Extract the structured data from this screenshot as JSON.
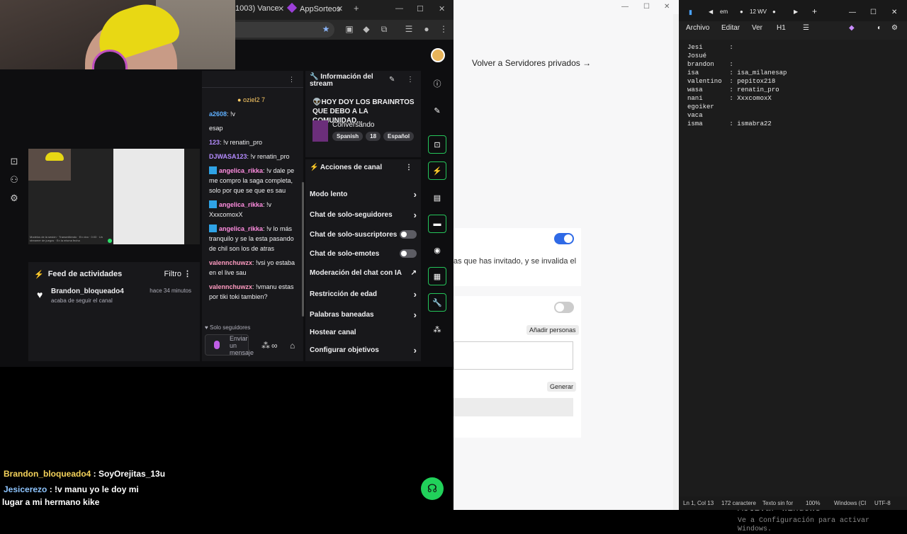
{
  "browser": {
    "tab1_label": "1003) Vance",
    "tab2_label": "AppSorteos",
    "tab1_close": "✕",
    "tab2_close": "✕",
    "new_tab": "+",
    "win_min": "—",
    "win_max": "☐",
    "win_close": "✕"
  },
  "preview": {
    "caption": "Modelos de la sesión · Transmitiendo · En vivo · 0:03 · Un streamer de juegos · En la misma fecha"
  },
  "activity_feed": {
    "title": "Feed de actividades",
    "filter_label": "Filtro",
    "event_user": "Brandon_bloqueado4",
    "event_time": "hace 34 minutos",
    "event_text": "acaba de seguir el canal"
  },
  "chat": {
    "pinned": "oziel2 7",
    "messages": [
      {
        "user": "a2608",
        "text": ": !v",
        "color": "#5fb0ff"
      },
      {
        "user": "",
        "text": "esap",
        "color": "#efeff1"
      },
      {
        "user": "123",
        "text": ": !v renatin_pro",
        "color": "#b58cff"
      },
      {
        "user": "DJWASA123",
        "text": ": !v renatin_pro",
        "color": "#b58cff"
      },
      {
        "user": "angelica_rikka",
        "text": ": !v dale pe me compro la saga completa, solo por que se que es sau",
        "color": "#ff8de0",
        "badge": true
      },
      {
        "user": "angelica_rikka",
        "text": ": !v XxxcomoxX",
        "color": "#ff8de0",
        "badge": true
      },
      {
        "user": "angelica_rikka",
        "text": ": !v lo más tranquilo y se la esta pasando de chil son los de atras",
        "color": "#ff8de0",
        "badge": true
      },
      {
        "user": "valennchuwzx",
        "text": ": !vsi yo estaba en el live sau",
        "color": "#ff9bc1"
      },
      {
        "user": "valennchuwzx",
        "text": ": !vmanu estas por tiki toki tambien?",
        "color": "#ff9bc1"
      }
    ],
    "followers_only": "Solo seguidores",
    "send_placeholder": "Enviar un mensaje"
  },
  "stream_info": {
    "header": "Información del stream",
    "title": "👽HOY DOY LOS BRAINRTOS QUE DEBO A LA COMUNIDAD...",
    "category": "Conversando",
    "tags": [
      "Spanish",
      "18",
      "Español"
    ]
  },
  "channel_actions": {
    "header": "Acciones de canal",
    "items": [
      {
        "label": "Modo lento",
        "control": "chevron"
      },
      {
        "label": "Chat de solo-seguidores",
        "control": "chevron"
      },
      {
        "label": "Chat de solo-suscriptores",
        "control": "toggle"
      },
      {
        "label": "Chat de solo-emotes",
        "control": "toggle"
      },
      {
        "label": "Moderación del chat con IA",
        "control": "chart"
      },
      {
        "label": "Restricción de edad",
        "control": "chevron"
      },
      {
        "label": "Palabras baneadas",
        "control": "chevron"
      },
      {
        "label": "Hostear canal",
        "control": "none"
      },
      {
        "label": "Configurar objetivos",
        "control": "chevron"
      }
    ]
  },
  "overlay_chat": {
    "line1_user": "Brandon_bloqueado4",
    "line1_text": " : SoyOrejitas_13u",
    "line2_user": "Jesicerezo",
    "line2_text": " : !v manu yo le doy mi",
    "line3_text": "lugar a mi hermano kike"
  },
  "settings_page": {
    "back_link": "Volver a Servidores privados →",
    "invite_text": "as que has invitado, y se invalida el",
    "add_people": "Añadir personas",
    "generate": "Generar",
    "toggle_1_on": true,
    "toggle_2_on": false
  },
  "notepad": {
    "tab_em": "em",
    "tab_12wv": "12 WV",
    "new_tab": "+",
    "menu": [
      "Archivo",
      "Editar",
      "Ver",
      "H1"
    ],
    "lines": [
      "Jesi       :",
      "Josué",
      "brandon    :",
      "isa        : isa_milanesap",
      "valentino  : pepitox218",
      "wasa       : renatin_pro",
      "nani       : XxxcomoxX",
      "egoiker",
      "vaca",
      "isma       : ismabra22"
    ],
    "activate_title": "Activar Windows",
    "activate_sub": "Ve a Configuración para activar Windows.",
    "status": {
      "position": "Ln 1, Col 13",
      "chars": "172 caractere",
      "format": "Texto sin for",
      "zoom": "100%",
      "eol": "Windows (CI",
      "encoding": "UTF-8"
    }
  }
}
